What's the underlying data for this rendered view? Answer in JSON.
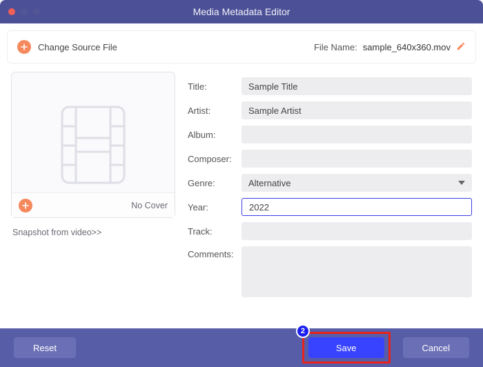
{
  "window": {
    "title": "Media Metadata Editor"
  },
  "header": {
    "change_source_label": "Change Source File",
    "filename_label": "File Name:",
    "filename_value": "sample_640x360.mov"
  },
  "cover": {
    "no_cover_label": "No Cover",
    "snapshot_link": "Snapshot from video>>"
  },
  "form": {
    "title_label": "Title:",
    "title_value": "Sample Title",
    "artist_label": "Artist:",
    "artist_value": "Sample Artist",
    "album_label": "Album:",
    "album_value": "",
    "composer_label": "Composer:",
    "composer_value": "",
    "genre_label": "Genre:",
    "genre_value": "Alternative",
    "year_label": "Year:",
    "year_value": "2022",
    "track_label": "Track:",
    "track_value": "",
    "comments_label": "Comments:",
    "comments_value": ""
  },
  "footer": {
    "reset_label": "Reset",
    "save_label": "Save",
    "cancel_label": "Cancel",
    "badge_number": "2"
  },
  "colors": {
    "accent_orange": "#f5895d",
    "primary_blue": "#3843ff",
    "header_purple": "#4c5197",
    "highlight_red": "#e8231b"
  }
}
